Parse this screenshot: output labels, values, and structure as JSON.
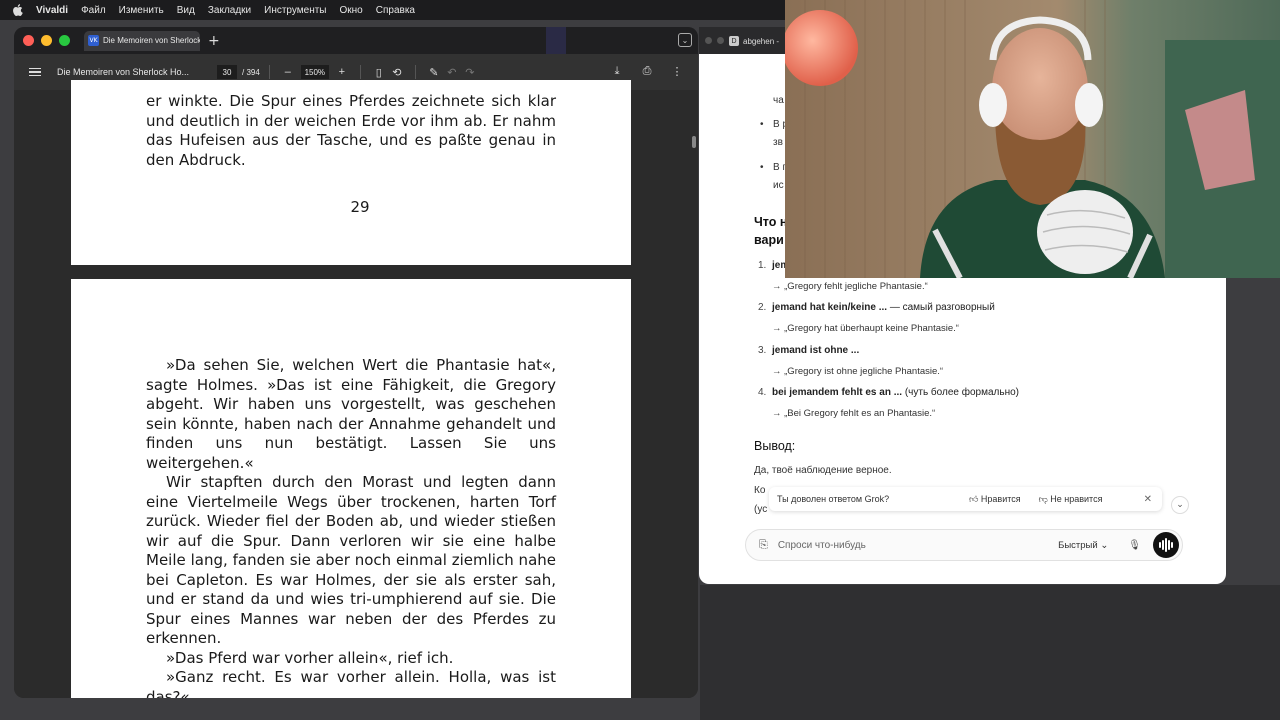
{
  "menubar": {
    "app": "Vivaldi",
    "items": [
      "Файл",
      "Изменить",
      "Вид",
      "Закладки",
      "Инструменты",
      "Окно",
      "Справка"
    ]
  },
  "browser": {
    "tab_title": "Die Memoiren von Sherlock",
    "favicon_text": "VK",
    "new_tab": "+"
  },
  "pdf_toolbar": {
    "doc_title": "Die Memoiren von Sherlock Ho...",
    "page_current": "30",
    "page_total": "/ 394",
    "zoom_minus": "–",
    "zoom": "150%",
    "zoom_plus": "+"
  },
  "pdf": {
    "page1_lines": "er winkte. Die Spur eines Pferdes zeichnete sich klar und deutlich in der weichen Erde vor ihm ab. Er nahm das Hufeisen aus der Tasche, und es paßte genau in den Abdruck.",
    "page_number": "29",
    "page2_paragraphs": [
      "»Da sehen Sie, welchen Wert die Phantasie hat«, sagte Holmes. »Das ist eine Fähigkeit, die Gregory abgeht. Wir haben uns vorgestellt, was geschehen sein könnte, haben nach der Annahme gehandelt und finden uns nun bestätigt. Lassen Sie uns weitergehen.«",
      "Wir stapften durch den Morast und legten dann eine Viertelmeile Wegs über trockenen, harten Torf zurück. Wieder fiel der Boden ab, und wieder stießen wir auf die Spur. Dann verloren wir sie eine halbe Meile lang, fanden sie aber noch einmal ziemlich nahe bei Capleton. Es war Holmes, der sie als erster sah, und er stand da und wies tri-umphierend auf sie. Die Spur eines Mannes war neben der des Pferdes zu erkennen.",
      "»Das Pferd war vorher allein«, rief ich.",
      "»Ganz recht. Es war vorher allein. Holla, was ist das?«"
    ]
  },
  "grok": {
    "tab_title": "abgehen -",
    "tab_favicon": "D",
    "frag_top": "ча",
    "bullets": [
      "В р",
      "зв",
      "В п",
      "ис"
    ],
    "heading_partial": "Что н",
    "heading_partial2": "вари",
    "list": [
      {
        "n": "1.",
        "title": "jemand",
        "rest": "",
        "example": "→ „Gregory fehlt jegliche Phantasie.“"
      },
      {
        "n": "2.",
        "title": "jemand hat kein/keine ...",
        "rest": " — самый разговорный",
        "example": "→ „Gregory hat überhaupt keine Phantasie.“"
      },
      {
        "n": "3.",
        "title": "jemand ist ohne ...",
        "rest": "",
        "example": "→ „Gregory ist ohne jegliche Phantasie.“"
      },
      {
        "n": "4.",
        "title": "bei jemandem fehlt es an ...",
        "rest": " (чуть более формально)",
        "example": "→ „Bei Gregory fehlt es an Phantasie.“"
      }
    ],
    "conclusion_heading": "Вывод:",
    "conclusion_text": "Да, твоё наблюдение верное.",
    "conclusion_frag1": "Ко",
    "conclusion_frag2": "(ус",
    "feedback_question": "Ты доволен ответом Grok?",
    "like": "Нравится",
    "dislike": "Не нравится",
    "input_placeholder": "Спроси что-нибудь",
    "mode": "Быстрый"
  }
}
